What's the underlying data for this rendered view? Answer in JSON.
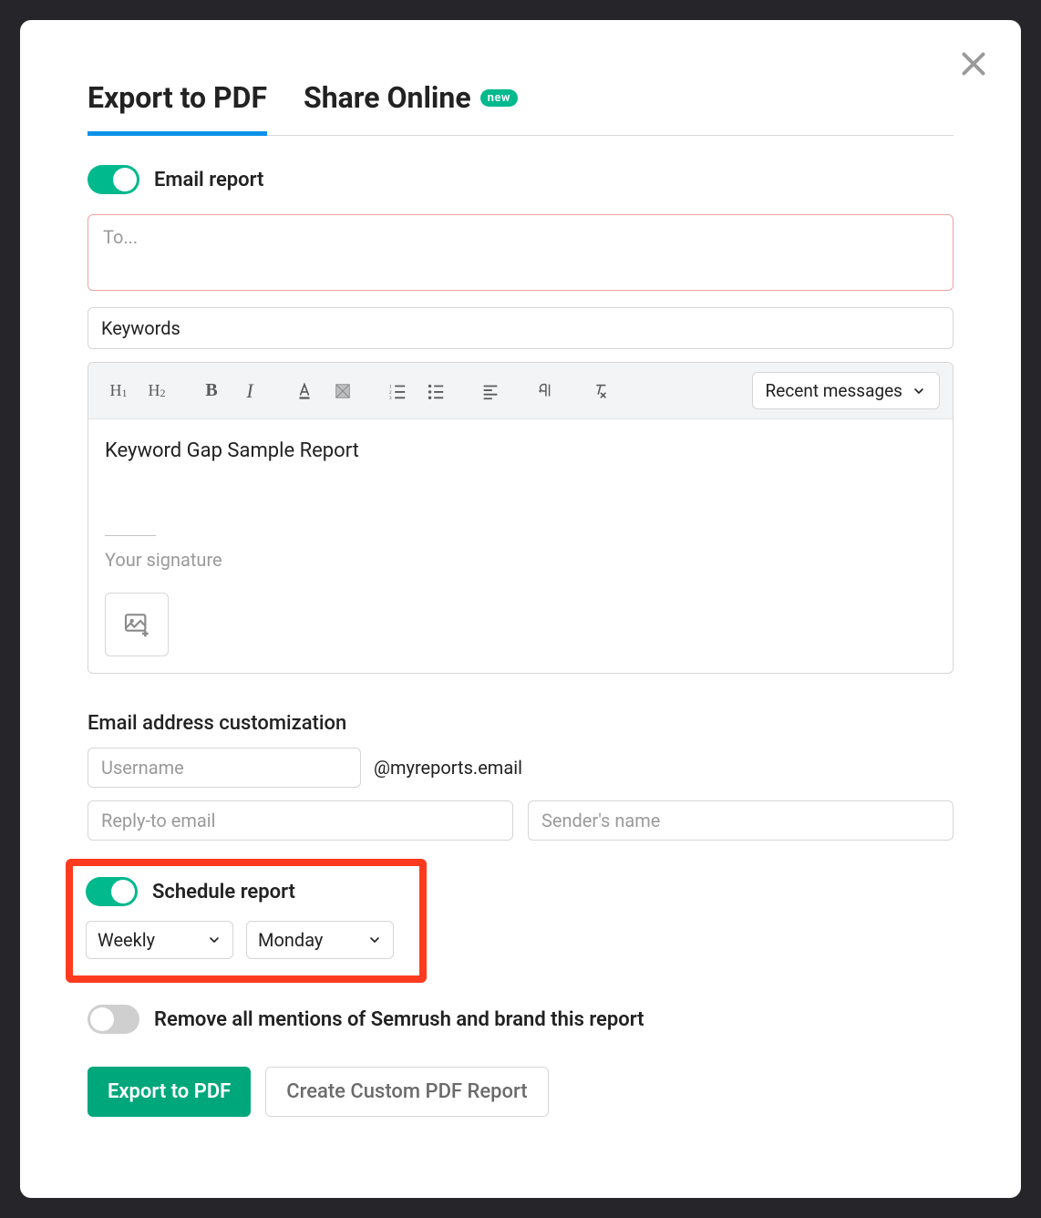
{
  "tabs": {
    "export_pdf": "Export to PDF",
    "share_online": "Share Online",
    "new_badge": "new"
  },
  "email_report": {
    "toggle_label": "Email report",
    "to_placeholder": "To...",
    "subject_value": "Keywords"
  },
  "editor": {
    "recent_label": "Recent messages",
    "body_text": "Keyword Gap Sample Report",
    "signature_placeholder": "Your signature"
  },
  "email_custom": {
    "section_title": "Email address customization",
    "username_placeholder": "Username",
    "domain": "@myreports.email",
    "reply_placeholder": "Reply-to email",
    "sender_placeholder": "Sender's name"
  },
  "schedule": {
    "toggle_label": "Schedule report",
    "frequency": "Weekly",
    "day": "Monday"
  },
  "branding": {
    "toggle_label": "Remove all mentions of Semrush and brand this report"
  },
  "actions": {
    "primary": "Export to PDF",
    "secondary": "Create Custom PDF Report"
  }
}
